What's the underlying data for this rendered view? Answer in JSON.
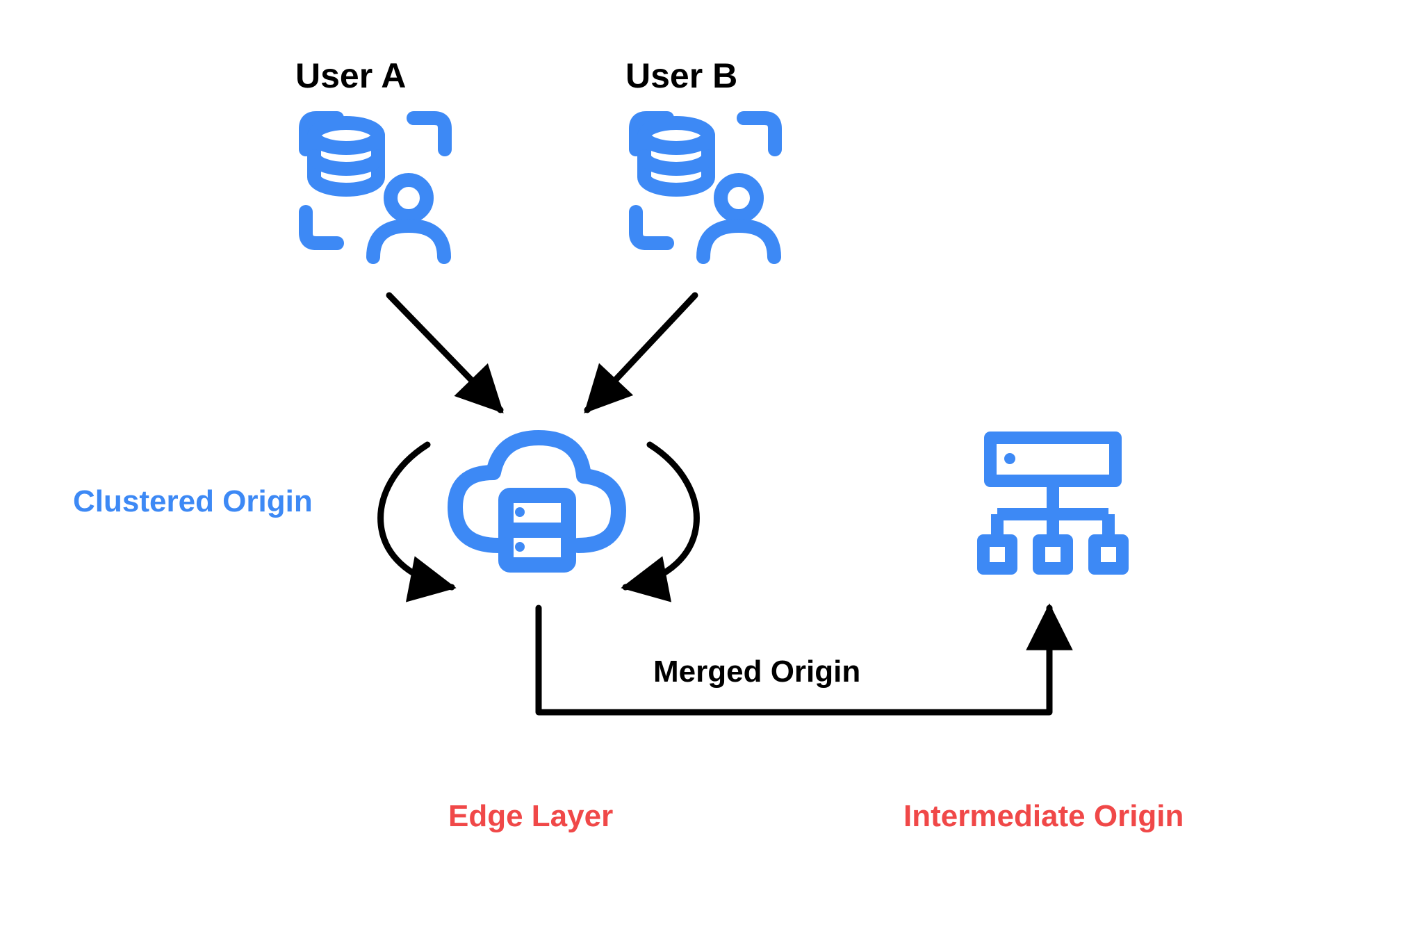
{
  "nodes": {
    "user_a": {
      "label": "User A"
    },
    "user_b": {
      "label": "User B"
    },
    "clustered_origin": {
      "label": "Clustered Origin"
    },
    "merged_origin": {
      "label": "Merged Origin"
    },
    "edge_layer": {
      "label": "Edge Layer"
    },
    "intermediate_origin": {
      "label": "Intermediate Origin"
    }
  },
  "colors": {
    "blue": "#3D89F5",
    "red": "#F04848",
    "black": "#000000"
  }
}
